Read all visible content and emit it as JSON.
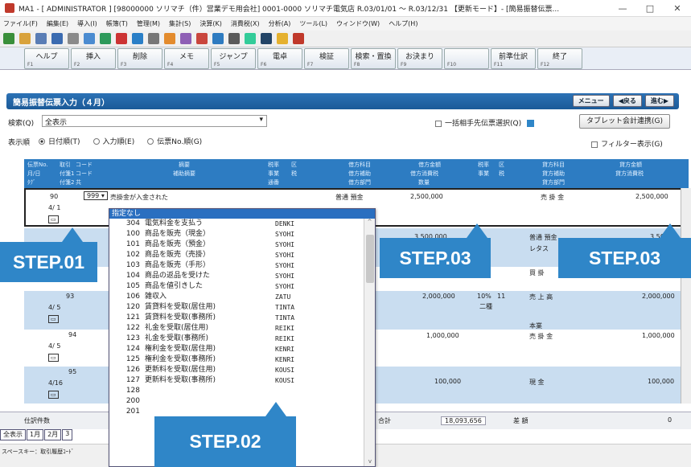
{
  "window": {
    "title": "MA1 - [ ADMINISTRATOR ] [98000000 ソリマチ（件）営業デモ用会社] 0001-0000 ソリマチ電気店 R.03/01/01 ～ R.03/12/31 【更新モード】- [簡易振替伝票...",
    "minimize": "—",
    "maximize": "□",
    "close": "✕"
  },
  "menu": [
    "ファイル(F)",
    "編集(E)",
    "導入(I)",
    "帳簿(T)",
    "管理(M)",
    "集計(S)",
    "決算(K)",
    "消費税(X)",
    "分析(A)",
    "ツール(L)",
    "ウィンドウ(W)",
    "ヘルプ(H)"
  ],
  "function_keys": [
    {
      "label": "ヘルプ",
      "key": "F1"
    },
    {
      "label": "挿入",
      "key": "F2"
    },
    {
      "label": "削除",
      "key": "F3"
    },
    {
      "label": "メモ",
      "key": "F4"
    },
    {
      "label": "ジャンプ",
      "key": "F5"
    },
    {
      "label": "電卓",
      "key": "F6"
    },
    {
      "label": "検証",
      "key": "F7"
    },
    {
      "label": "検索・置換",
      "key": "F8"
    },
    {
      "label": "お決まり",
      "key": "F9"
    },
    {
      "label": "",
      "key": "F10"
    },
    {
      "label": "前準仕訳",
      "key": "F11"
    },
    {
      "label": "終了",
      "key": "F12"
    }
  ],
  "header": {
    "title": "簡易振替伝票入力（４月）",
    "menu_btn": "メニュー",
    "back_btn": "◀戻る",
    "next_btn": "進む▶"
  },
  "search": {
    "label": "検索(Q)",
    "value": "全表示"
  },
  "bulk_check": "一括相手先伝票選択(Q)",
  "tablet_btn": "タブレット会計連携(G)",
  "display_order": {
    "label": "表示順",
    "options": [
      "日付順(T)",
      "入力順(E)",
      "伝票No.順(G)"
    ],
    "selected": 0
  },
  "filter": "フィルター表示(G)",
  "grid_header": {
    "r1": [
      "伝票No.",
      "取引",
      "コード",
      "摘要",
      "税率",
      "区",
      "借方科目",
      "借方金額",
      "税率",
      "区",
      "貸方科目",
      "貸方金額"
    ],
    "r2": [
      "月/日",
      "付箋1",
      "コード",
      "補助摘要",
      "事業",
      "税",
      "借方補助",
      "借方消費税",
      "事業",
      "税",
      "貸方補助",
      "貸方消費税"
    ],
    "r3": [
      "ﾀｸﾞ",
      "付箋2",
      "共",
      "",
      "通番",
      "",
      "借方部門",
      "数量",
      "",
      "",
      "貸方部門",
      ""
    ]
  },
  "rows": [
    {
      "no": "90",
      "date": "4/ 1",
      "code": "999",
      "desc": "売掛金が入金された",
      "debit": "普通 預金",
      "debit_amt": "2,500,000",
      "credit": "売 掛 金",
      "credit_amt": "2,500,000"
    },
    {
      "no": "",
      "date": "",
      "code": "",
      "desc": "",
      "debit": "",
      "debit_amt": "3,500,000",
      "credit": "普通 預金",
      "credit_amt": "3,500,",
      "credit_sub": "レタス"
    },
    {
      "no": "",
      "date": "",
      "code": "",
      "desc": "",
      "debit": "",
      "debit_amt": "",
      "credit": "買 掛",
      "credit_amt": ""
    },
    {
      "no": "93",
      "date": "4/ 5",
      "code": "",
      "desc": "",
      "debit": "",
      "debit_amt": "2,000,000",
      "rate": "10%",
      "ku": "11",
      "rate_sub": "二種",
      "credit": "売 上 高",
      "credit_amt": "2,000,000"
    },
    {
      "no": "94",
      "date": "4/ 5",
      "code": "",
      "desc": "",
      "debit": "",
      "debit_amt": "1,000,000",
      "credit_sub": "本業",
      "credit": "売 掛 金",
      "credit_amt": "1,000,000"
    },
    {
      "no": "95",
      "date": "4/16",
      "code": "",
      "desc": "",
      "debit": "",
      "debit_amt": "100,000",
      "credit": "現 金",
      "credit_amt": "100,000"
    }
  ],
  "footer": {
    "count_label": "仕訳件数",
    "total_label": "合計",
    "total": "18,093,656",
    "diff_label": "差 額",
    "diff": "0"
  },
  "bottom_tabs": [
    "全表示",
    "1月",
    "2月",
    "3"
  ],
  "status": "スペースキー：取引履歴ｺｰﾄﾞ",
  "dropdown": {
    "current_code": "999",
    "selected": "指定なし",
    "items": [
      {
        "code": "304",
        "name": "電気料金を支払う",
        "kana": "DENKI"
      },
      {
        "code": "100",
        "name": "商品を販売（現金）",
        "kana": "SYOHI"
      },
      {
        "code": "101",
        "name": "商品を販売（預金）",
        "kana": "SYOHI"
      },
      {
        "code": "102",
        "name": "商品を販売（売掛）",
        "kana": "SYOHI"
      },
      {
        "code": "103",
        "name": "商品を販売（手形）",
        "kana": "SYOHI"
      },
      {
        "code": "104",
        "name": "商品の返品を受けた",
        "kana": "SYOHI"
      },
      {
        "code": "105",
        "name": "商品を値引きした",
        "kana": "SYOHI"
      },
      {
        "code": "106",
        "name": "雑収入",
        "kana": "ZATU"
      },
      {
        "code": "120",
        "name": "賃貸料を受取(居住用)",
        "kana": "TINTA"
      },
      {
        "code": "121",
        "name": "賃貸料を受取(事務所)",
        "kana": "TINTA"
      },
      {
        "code": "122",
        "name": "礼金を受取(居住用)",
        "kana": "REIKI"
      },
      {
        "code": "123",
        "name": "礼金を受取(事務所)",
        "kana": "REIKI"
      },
      {
        "code": "124",
        "name": "権利金を受取(居住用)",
        "kana": "KENRI"
      },
      {
        "code": "125",
        "name": "権利金を受取(事務所)",
        "kana": "KENRI"
      },
      {
        "code": "126",
        "name": "更新料を受取(居住用)",
        "kana": "KOUSI"
      },
      {
        "code": "127",
        "name": "更新料を受取(事務所)",
        "kana": "KOUSI"
      },
      {
        "code": "128",
        "name": "",
        "kana": ""
      },
      {
        "code": "200",
        "name": "",
        "kana": ""
      },
      {
        "code": "201",
        "name": "",
        "kana": ""
      }
    ]
  },
  "steps": {
    "s1": "STEP.01",
    "s2": "STEP.02",
    "s3a": "STEP.03",
    "s3b": "STEP.03"
  },
  "colors": {
    "accent": "#2f86c8",
    "header": "#1b5a98",
    "row_alt": "#c9ddf0"
  }
}
